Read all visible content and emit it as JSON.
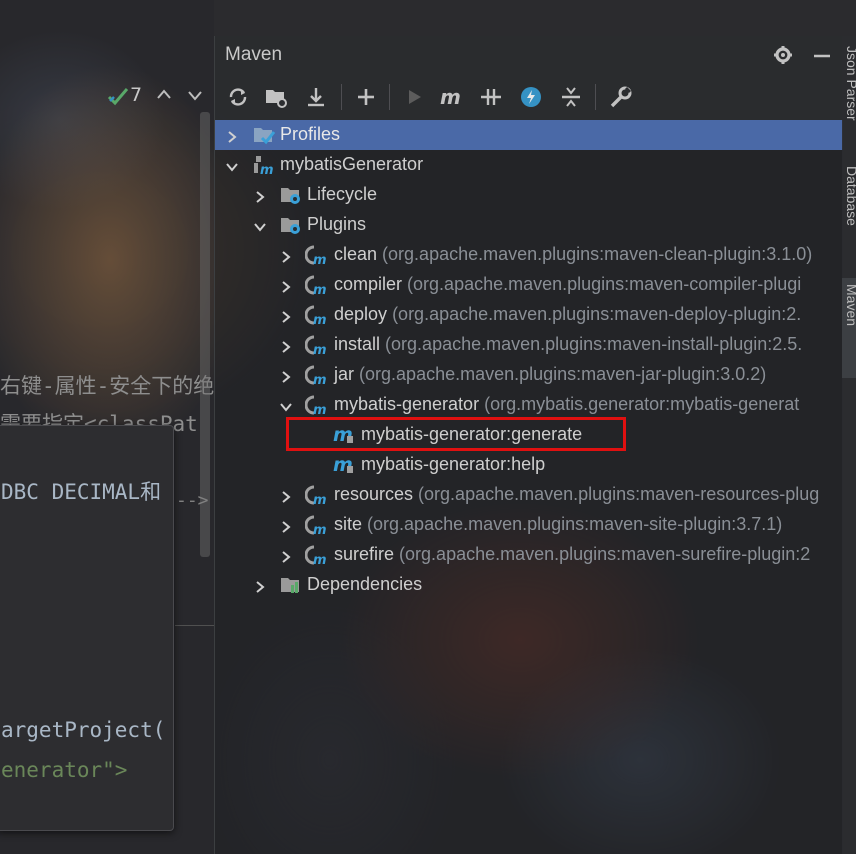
{
  "editor": {
    "inspection_count": "7",
    "code_lines": [
      "右键-属性-安全下的绝",
      "需要指定<classPat"
    ],
    "popup_lines": [
      "DBC DECIMAL和",
      "-->",
      "argetProject(",
      "enerator\">"
    ]
  },
  "maven": {
    "title": "Maven",
    "header_icons": [
      "gear-icon",
      "minimize-icon"
    ],
    "toolbar_icons": [
      "reload-icon",
      "reimport-folder-icon",
      "download-icon",
      "add-icon",
      "run-icon",
      "execute-goal-icon",
      "toggle-offline-icon",
      "skip-tests-icon",
      "collapse-all-icon",
      "settings-wrench-icon"
    ],
    "tree": {
      "profiles": "Profiles",
      "project": "mybatisGenerator",
      "lifecycle": "Lifecycle",
      "plugins": "Plugins",
      "plugin_items": [
        {
          "name": "clean",
          "coord": "(org.apache.maven.plugins:maven-clean-plugin:3.1.0)"
        },
        {
          "name": "compiler",
          "coord": "(org.apache.maven.plugins:maven-compiler-plugi"
        },
        {
          "name": "deploy",
          "coord": "(org.apache.maven.plugins:maven-deploy-plugin:2."
        },
        {
          "name": "install",
          "coord": "(org.apache.maven.plugins:maven-install-plugin:2.5."
        },
        {
          "name": "jar",
          "coord": "(org.apache.maven.plugins:maven-jar-plugin:3.0.2)"
        },
        {
          "name": "mybatis-generator",
          "coord": "(org.mybatis.generator:mybatis-generat"
        }
      ],
      "goals": [
        "mybatis-generator:generate",
        "mybatis-generator:help"
      ],
      "plugin_items_after": [
        {
          "name": "resources",
          "coord": "(org.apache.maven.plugins:maven-resources-plug"
        },
        {
          "name": "site",
          "coord": "(org.apache.maven.plugins:maven-site-plugin:3.7.1)"
        },
        {
          "name": "surefire",
          "coord": "(org.apache.maven.plugins:maven-surefire-plugin:2"
        }
      ],
      "dependencies": "Dependencies"
    }
  },
  "right_stripe": {
    "tabs": [
      "Json Parser",
      "Database",
      "Maven"
    ]
  },
  "colors": {
    "selection": "#4a69a7",
    "highlight_box": "#e01010",
    "maven_m_blue": "#3aa0d8",
    "string_green": "#6a8759",
    "tag_orange": "#e8bf6a"
  }
}
